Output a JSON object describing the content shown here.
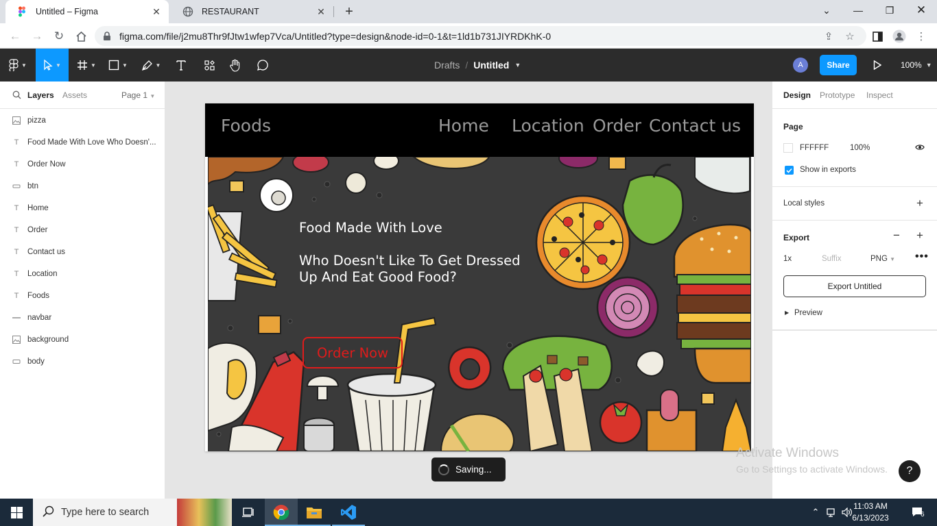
{
  "browser": {
    "tabs": [
      {
        "title": "Untitled – Figma"
      },
      {
        "title": "RESTAURANT"
      }
    ],
    "url": "figma.com/file/j2mu8Thr9fJtw1wfep7Vca/Untitled?type=design&node-id=0-1&t=1ld1b731JIYRDKhK-0"
  },
  "figma": {
    "breadcrumb_drafts": "Drafts",
    "breadcrumb_slash": "/",
    "file_name": "Untitled",
    "avatar_initial": "A",
    "share_label": "Share",
    "zoom": "100%",
    "left_panel": {
      "tab_layers": "Layers",
      "tab_assets": "Assets",
      "page_selector": "Page 1",
      "layers": [
        {
          "name": "pizza",
          "icon": "image-icon"
        },
        {
          "name": "Food Made With Love Who Doesn'...",
          "icon": "text-icon"
        },
        {
          "name": "Order Now",
          "icon": "text-icon"
        },
        {
          "name": "btn",
          "icon": "rectangle-icon"
        },
        {
          "name": "Home",
          "icon": "text-icon"
        },
        {
          "name": "Order",
          "icon": "text-icon"
        },
        {
          "name": "Contact us",
          "icon": "text-icon"
        },
        {
          "name": "Location",
          "icon": "text-icon"
        },
        {
          "name": "Foods",
          "icon": "text-icon"
        },
        {
          "name": "navbar",
          "icon": "line-icon"
        },
        {
          "name": "background",
          "icon": "image-icon"
        },
        {
          "name": "body",
          "icon": "rectangle-icon"
        }
      ]
    },
    "canvas": {
      "nav": {
        "brand": "Foods",
        "home": "Home",
        "location": "Location",
        "order": "Order",
        "contact": "Contact us"
      },
      "hero_title": "Food Made With Love",
      "hero_subtitle": "Who Doesn't Like To Get Dressed Up And Eat Good Food?",
      "order_button": "Order Now",
      "toast": "Saving..."
    },
    "right_panel": {
      "tab_design": "Design",
      "tab_prototype": "Prototype",
      "tab_inspect": "Inspect",
      "page_label": "Page",
      "page_color": "FFFFFF",
      "page_opacity": "100%",
      "show_in_exports": "Show in exports",
      "local_styles": "Local styles",
      "export_label": "Export",
      "export_scale": "1x",
      "export_suffix_placeholder": "Suffix",
      "export_format": "PNG",
      "export_button": "Export Untitled",
      "preview_label": "Preview"
    }
  },
  "watermark": {
    "title": "Activate Windows",
    "subtitle": "Go to Settings to activate Windows."
  },
  "help_label": "?",
  "taskbar": {
    "search_placeholder": "Type here to search",
    "time": "11:03 AM",
    "date": "6/13/2023",
    "notification_count": "6"
  },
  "colors": {
    "figma_accent": "#0d99ff",
    "toolbar_bg": "#2c2c2c",
    "order_button_red": "#e01b1b",
    "hero_bg": "#3a3a3a"
  }
}
